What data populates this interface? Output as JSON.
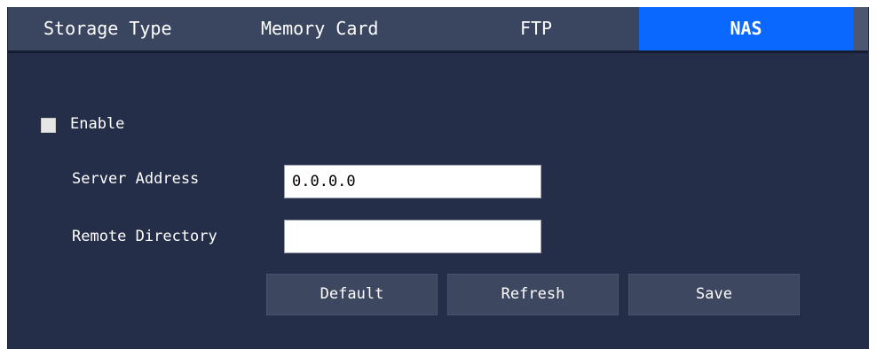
{
  "tabs": {
    "storage_type": "Storage Type",
    "memory_card": "Memory Card",
    "ftp": "FTP",
    "nas": "NAS",
    "active": "NAS"
  },
  "form": {
    "enable_label": "Enable",
    "enable_checked": false,
    "server_address_label": "Server Address",
    "server_address_value": "0.0.0.0",
    "remote_directory_label": "Remote Directory",
    "remote_directory_value": ""
  },
  "buttons": {
    "default_label": "Default",
    "refresh_label": "Refresh",
    "save_label": "Save"
  },
  "colors": {
    "panel_background": "#252e48",
    "tab_bar_background": "#3a4560",
    "active_tab": "#0a68ff",
    "button_background": "#3d475f"
  }
}
